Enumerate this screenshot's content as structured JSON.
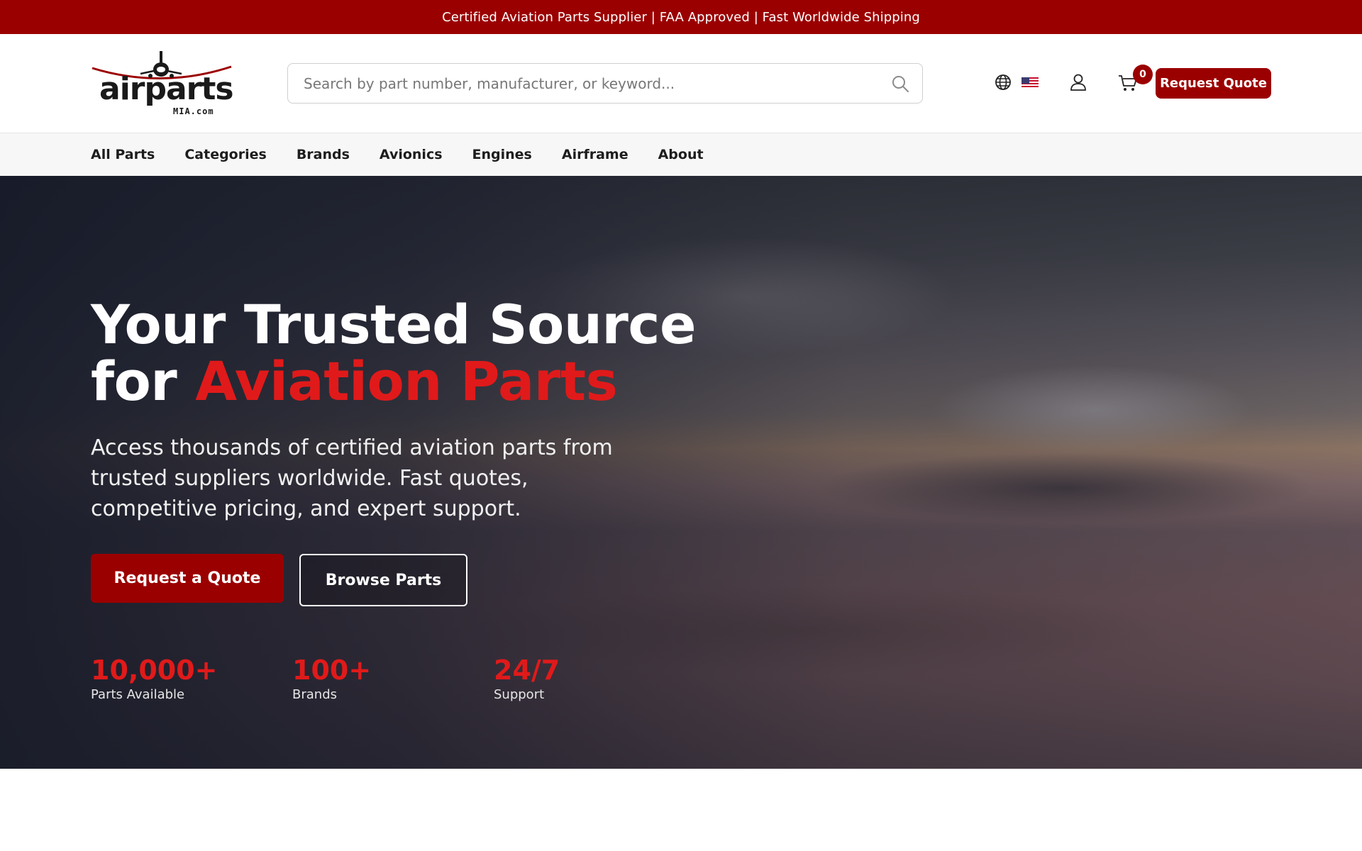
{
  "promo_bar": {
    "text": "Certified Aviation Parts Supplier | FAA Approved | Fast Worldwide Shipping"
  },
  "header": {
    "logo": {
      "word": "airparts",
      "sub": "MIA.com"
    },
    "search": {
      "placeholder": "Search by part number, manufacturer, or keyword...",
      "value": ""
    },
    "icons": [
      "globe-icon",
      "us-flag-icon",
      "user-icon",
      "cart-icon",
      "search-icon"
    ],
    "cart_count": "0",
    "quote_button": "Request Quote"
  },
  "nav": {
    "items": [
      "All Parts",
      "Categories",
      "Brands",
      "Avionics",
      "Engines",
      "Airframe",
      "About"
    ]
  },
  "hero": {
    "title_line1": "Your Trusted Source",
    "title_line2_prefix": "for ",
    "title_line2_accent": "Aviation Parts",
    "subtitle": "Access thousands of certified aviation parts from trusted suppliers worldwide. Fast quotes, competitive pricing, and expert support.",
    "primary_button": "Request a Quote",
    "secondary_button": "Browse Parts",
    "stats": [
      {
        "value": "10,000+",
        "label": "Parts Available"
      },
      {
        "value": "100+",
        "label": "Brands"
      },
      {
        "value": "24/7",
        "label": "Support"
      }
    ]
  },
  "colors": {
    "brand_red": "#9b0000",
    "accent_red": "#e01a1a",
    "nav_bg": "#f7f7f7"
  }
}
